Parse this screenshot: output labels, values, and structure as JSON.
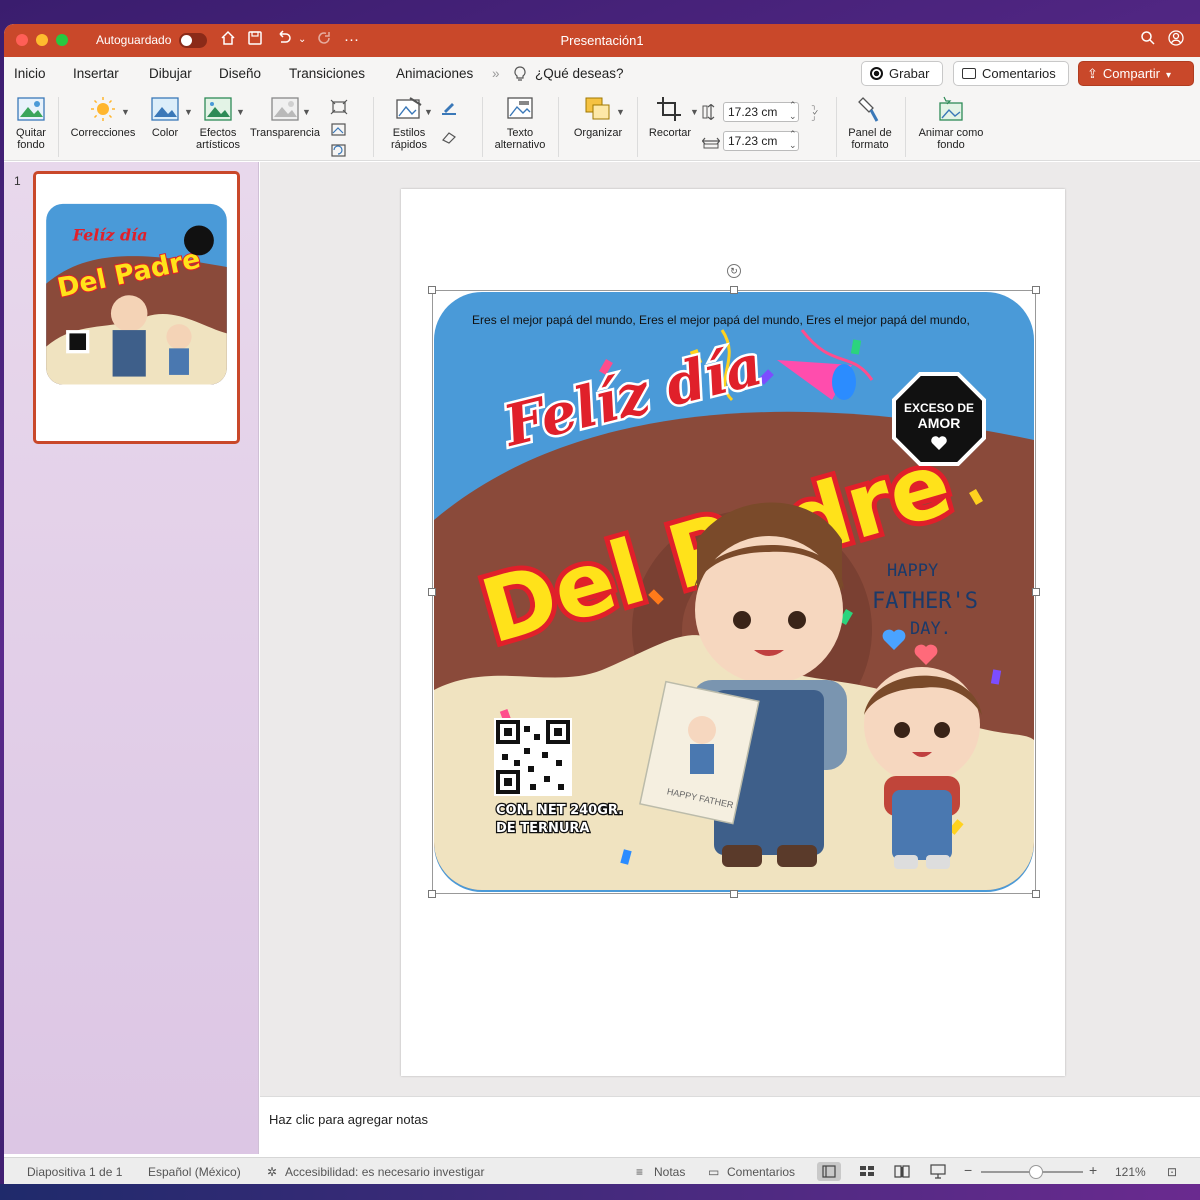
{
  "titlebar": {
    "autosave_label": "Autoguardado",
    "doc_title": "Presentación1"
  },
  "menu": {
    "tabs": [
      "Inicio",
      "Insertar",
      "Dibujar",
      "Diseño",
      "Transiciones",
      "Animaciones"
    ],
    "search_label": "¿Qué deseas?",
    "record_label": "Grabar",
    "comments_label": "Comentarios",
    "share_label": "Compartir"
  },
  "ribbon": {
    "remove_bg": "Quitar fondo",
    "corrections": "Correcciones",
    "color": "Color",
    "artistic_effects": "Efectos artísticos",
    "transparency": "Transparencia",
    "quick_styles": "Estilos rápidos",
    "alt_text": "Texto alternativo",
    "arrange": "Organizar",
    "crop": "Recortar",
    "height_value": "17.23 cm",
    "width_value": "17.23 cm",
    "format_pane": "Panel de formato",
    "animate_bg": "Animar como fondo"
  },
  "thumbnails": {
    "slide_number": "1"
  },
  "label": {
    "script_title": "Felíz día",
    "main_title": "Del Padre",
    "border_text": "Eres el mejor papá del mundo, Eres el mejor papá del mundo, Eres el mejor papá del mundo,",
    "badge_line1": "EXCESO DE",
    "badge_line2": "AMOR",
    "happy_line1": "HAPPY",
    "happy_line2": "FATHER'S",
    "happy_line3": "DAY.",
    "net_line1": "CON. NET 240GR.",
    "net_line2": "DE TERNURA",
    "card_text": "HAPPY FATHER"
  },
  "notes": {
    "placeholder": "Haz clic para agregar notas"
  },
  "status": {
    "slide_info": "Diapositiva 1 de 1",
    "language": "Español (México)",
    "accessibility": "Accesibilidad: es necesario investigar",
    "notes_label": "Notas",
    "comments_label": "Comentarios",
    "zoom": "121%"
  },
  "colors": {
    "accent": "#c9482a",
    "label_sky": "#4a9ad8",
    "label_choc": "#8a4a3a",
    "label_cream": "#f0e3c0",
    "title_yellow": "#ffe21a",
    "title_red": "#e0202a"
  },
  "icons": [
    "home-icon",
    "save-icon",
    "undo-icon",
    "redo-icon",
    "more-icon",
    "search-icon",
    "account-icon",
    "lightbulb-icon",
    "record-icon",
    "comment-icon",
    "share-icon"
  ]
}
